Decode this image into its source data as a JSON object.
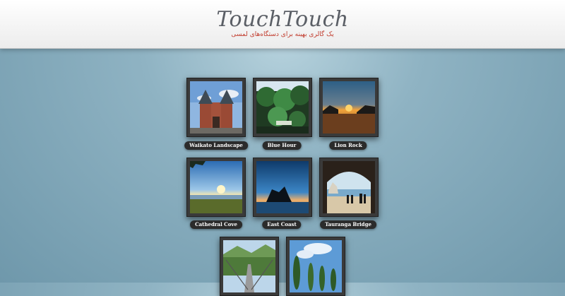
{
  "header": {
    "logo": "TouchTouch",
    "tagline": "یک گالری بهینه برای دستگاه‌های لمسی"
  },
  "gallery": {
    "items": [
      {
        "caption": "Waikato Landscape"
      },
      {
        "caption": "Blue Hour"
      },
      {
        "caption": "Lion Rock"
      },
      {
        "caption": "Cathedral Cove"
      },
      {
        "caption": "East Coast"
      },
      {
        "caption": "Tauranga Bridge"
      },
      {
        "caption": ""
      },
      {
        "caption": ""
      }
    ]
  }
}
